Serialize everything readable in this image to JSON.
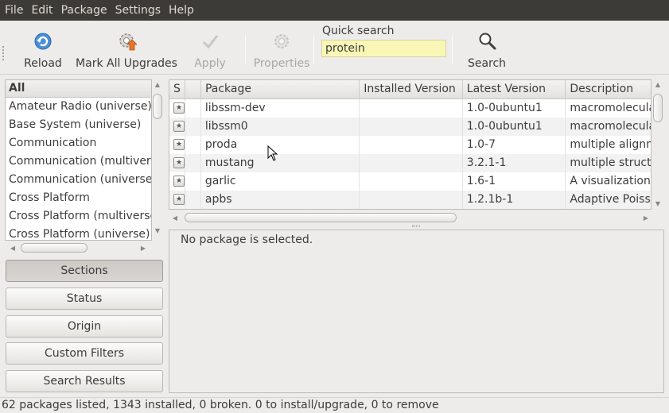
{
  "menubar": {
    "items": [
      "File",
      "Edit",
      "Package",
      "Settings",
      "Help"
    ]
  },
  "toolbar": {
    "reload_label": "Reload",
    "mark_all_label": "Mark All Upgrades",
    "apply_label": "Apply",
    "properties_label": "Properties",
    "quick_search_label": "Quick search",
    "quick_search_value": "protein",
    "search_label": "Search"
  },
  "sections": {
    "header": "All",
    "items": [
      "Amateur Radio (universe)",
      "Base System (universe)",
      "Communication",
      "Communication (multiverse)",
      "Communication (universe)",
      "Cross Platform",
      "Cross Platform (multiverse)",
      "Cross Platform (universe)"
    ]
  },
  "filters": {
    "sections_label": "Sections",
    "status_label": "Status",
    "origin_label": "Origin",
    "custom_label": "Custom Filters",
    "results_label": "Search Results",
    "active": "Sections"
  },
  "packages": {
    "columns": [
      "S",
      "",
      "Package",
      "Installed Version",
      "Latest Version",
      "Description"
    ],
    "rows": [
      {
        "name": "libssm-dev",
        "installed": "",
        "latest": "1.0-0ubuntu1",
        "description": "macromolecular"
      },
      {
        "name": "libssm0",
        "installed": "",
        "latest": "1.0-0ubuntu1",
        "description": "macromolecular"
      },
      {
        "name": "proda",
        "installed": "",
        "latest": "1.0-7",
        "description": "multiple alignment"
      },
      {
        "name": "mustang",
        "installed": "",
        "latest": "3.2.1-1",
        "description": "multiple structural"
      },
      {
        "name": "garlic",
        "installed": "",
        "latest": "1.6-1",
        "description": "A visualization"
      },
      {
        "name": "apbs",
        "installed": "",
        "latest": "1.2.1b-1",
        "description": "Adaptive Poisson"
      }
    ]
  },
  "details": {
    "message": "No package is selected."
  },
  "status": {
    "text": "62 packages listed, 1343 installed, 0 broken. 0 to install/upgrade, 0 to remove"
  },
  "colors": {
    "menubar_bg": "#3c3b37",
    "search_bg": "#faf6b5",
    "row_alt": "#f2f2f2"
  }
}
